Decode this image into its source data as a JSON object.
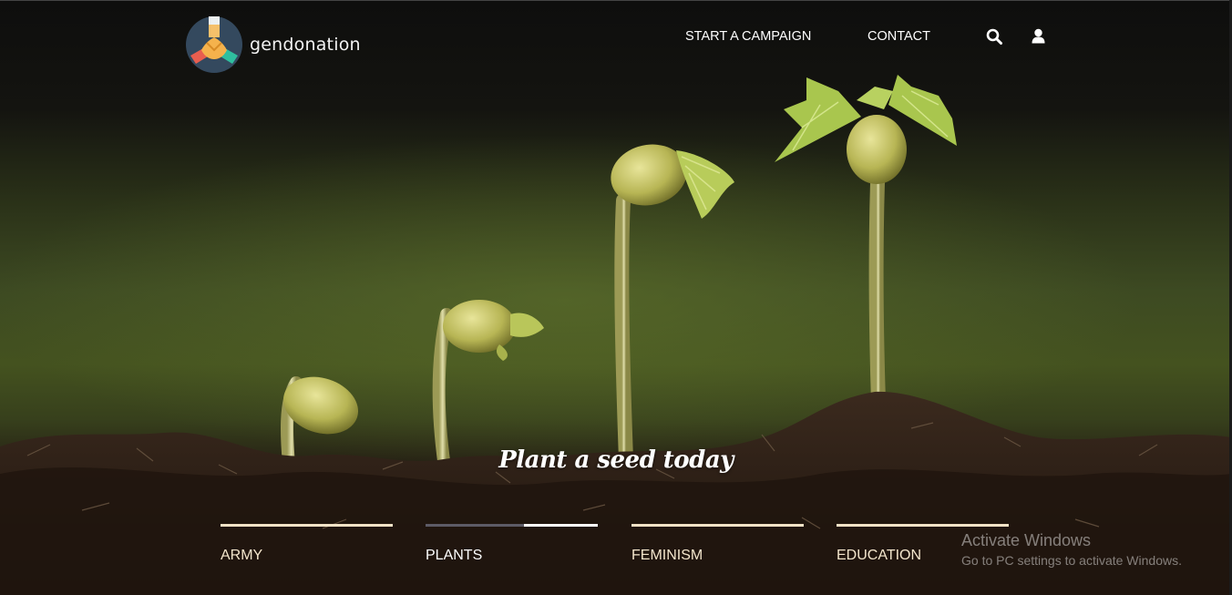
{
  "brand": {
    "name": "gendonation",
    "logo_icon": "joined-hands-icon"
  },
  "nav": {
    "items": [
      {
        "label": "START A CAMPAIGN"
      },
      {
        "label": "CONTACT"
      }
    ],
    "search_icon": "search-icon",
    "user_icon": "user-icon"
  },
  "hero": {
    "tagline": "Plant a seed today",
    "image": "seedlings-growth-stages"
  },
  "categories": [
    {
      "label": "ARMY",
      "progress": 1.0
    },
    {
      "label": "PLANTS",
      "progress": 0.43
    },
    {
      "label": "FEMINISM",
      "progress": 1.0
    },
    {
      "label": "EDUCATION",
      "progress": 1.0
    }
  ],
  "watermark": {
    "title": "Activate Windows",
    "subtitle": "Go to PC settings to activate Windows."
  },
  "colors": {
    "nav_text": "#ffffff",
    "category_text": "#f4e6cc",
    "category_bar": "#f1e2c6",
    "logo_bg": "#34495e"
  }
}
